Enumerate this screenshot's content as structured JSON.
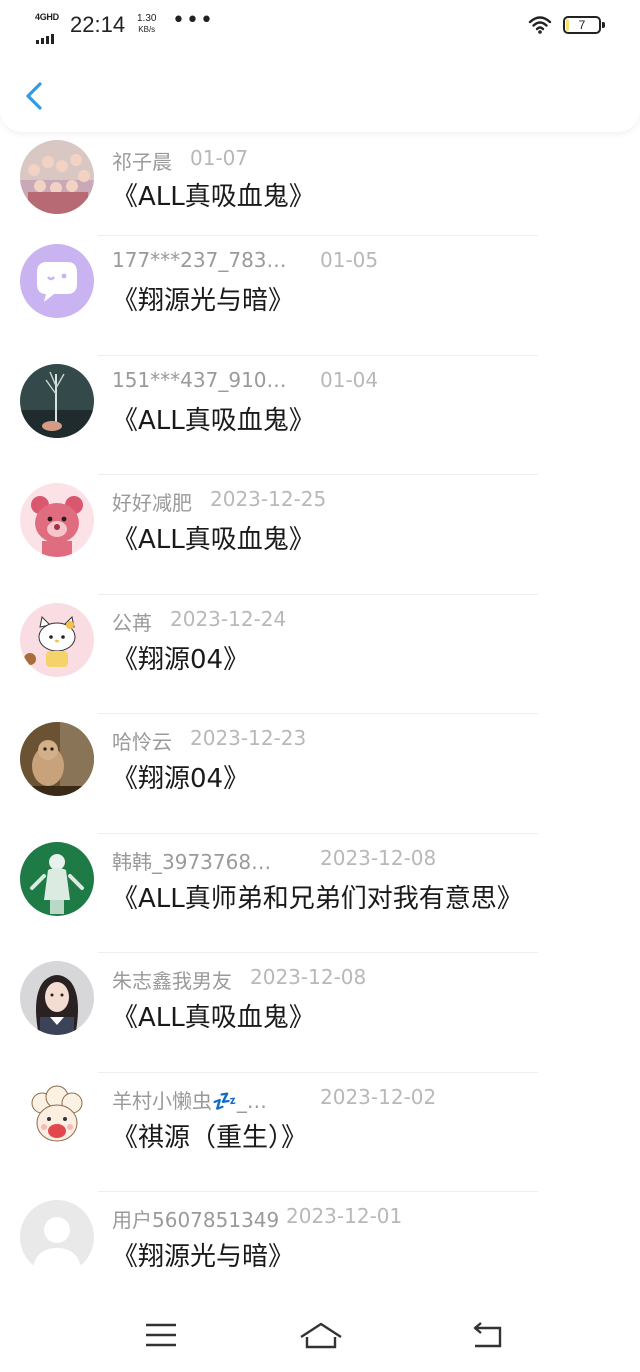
{
  "status_bar": {
    "network": "4GHD",
    "time": "22:14",
    "speed_value": "1.30",
    "speed_unit": "KB/s",
    "dots": "•••",
    "battery": "7",
    "battery_level": 0.07,
    "icons": [
      "signal-icon",
      "wifi-icon",
      "battery-icon"
    ]
  },
  "header": {
    "back_icon": "chevron-left-icon",
    "accent_color": "#2f9ae8"
  },
  "items": [
    {
      "name": "祁子晨",
      "date": "01-07",
      "book": "《ALL真吸血鬼》",
      "avatar": "group-photo"
    },
    {
      "name": "177***237_783…",
      "date": "01-05",
      "book": "《翔源光与暗》",
      "avatar": "purple-chat-bubble"
    },
    {
      "name": "151***437_910…",
      "date": "01-04",
      "book": "《ALL真吸血鬼》",
      "avatar": "plant-photo"
    },
    {
      "name": "好好减肥",
      "date": "2023-12-25",
      "book": "《ALL真吸血鬼》",
      "avatar": "pink-bear"
    },
    {
      "name": "公苒",
      "date": "2023-12-24",
      "book": "《翔源04》",
      "avatar": "hello-kitty"
    },
    {
      "name": "哈怜云",
      "date": "2023-12-23",
      "book": "《翔源04》",
      "avatar": "cat-photo"
    },
    {
      "name": "韩韩_3973768…",
      "date": "2023-12-08",
      "book": "《ALL真师弟和兄弟们对我有意思》",
      "avatar": "green-figure"
    },
    {
      "name": "朱志鑫我男友",
      "date": "2023-12-08",
      "book": "《ALL真吸血鬼》",
      "avatar": "girl-photo"
    },
    {
      "name": "羊村小懒虫💤_…",
      "date": "2023-12-02",
      "book": "《祺源（重生）》",
      "avatar": "sheep-cartoon"
    },
    {
      "name": "用户5607851349",
      "date": "2023-12-01",
      "book": "《翔源光与暗》",
      "avatar": "default-avatar"
    }
  ],
  "nav_bar": {
    "icons": [
      "menu-icon",
      "home-icon",
      "back-icon"
    ]
  }
}
